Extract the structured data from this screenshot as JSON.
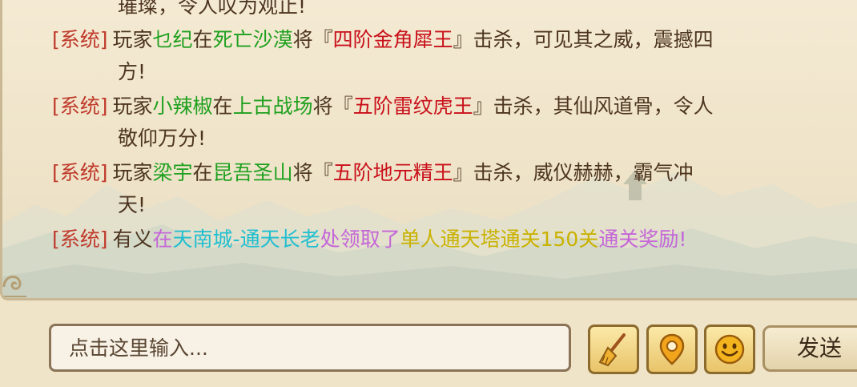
{
  "chat": {
    "lines": [
      {
        "parts": [
          "璀璨，令人叹为观止!"
        ]
      },
      {
        "tag": "[系统]",
        "parts": [
          "玩家",
          "乜纪",
          "在",
          "死亡沙漠",
          "将『",
          "四阶金角犀王",
          "』击杀，可见其之威，震撼四"
        ]
      },
      {
        "parts": [
          "方!"
        ]
      },
      {
        "tag": "[系统]",
        "parts": [
          "玩家",
          "小辣椒",
          "在",
          "上古战场",
          "将『",
          "五阶雷纹虎王",
          "』击杀，其仙风道骨，令人"
        ]
      },
      {
        "parts": [
          "敬仰万分!"
        ]
      },
      {
        "tag": "[系统]",
        "parts": [
          "玩家",
          "梁宇",
          "在",
          "昆吾圣山",
          "将『",
          "五阶地元精王",
          "』击杀，威仪赫赫，霸气冲"
        ]
      },
      {
        "parts": [
          "天!"
        ]
      },
      {
        "tag": "[系统]",
        "parts": [
          "有义",
          "在",
          "天南城-通天长老",
          "处领取了",
          "单人通天塔通关150关",
          "通关奖励!"
        ]
      }
    ]
  },
  "input": {
    "placeholder": "点击这里输入..."
  },
  "toolbar": {
    "clear_icon": "broom-icon",
    "location_icon": "location-pin-icon",
    "emoji_icon": "smiley-icon",
    "send_label": "发送"
  },
  "colors": {
    "system_tag": "#c0392b",
    "player_name": "#1fa01f",
    "boss_name": "#c9101a",
    "npc_location": "#1fbfd0",
    "action_text": "#c466d8",
    "reward_name": "#c9b200",
    "body_text": "#4d3520"
  }
}
